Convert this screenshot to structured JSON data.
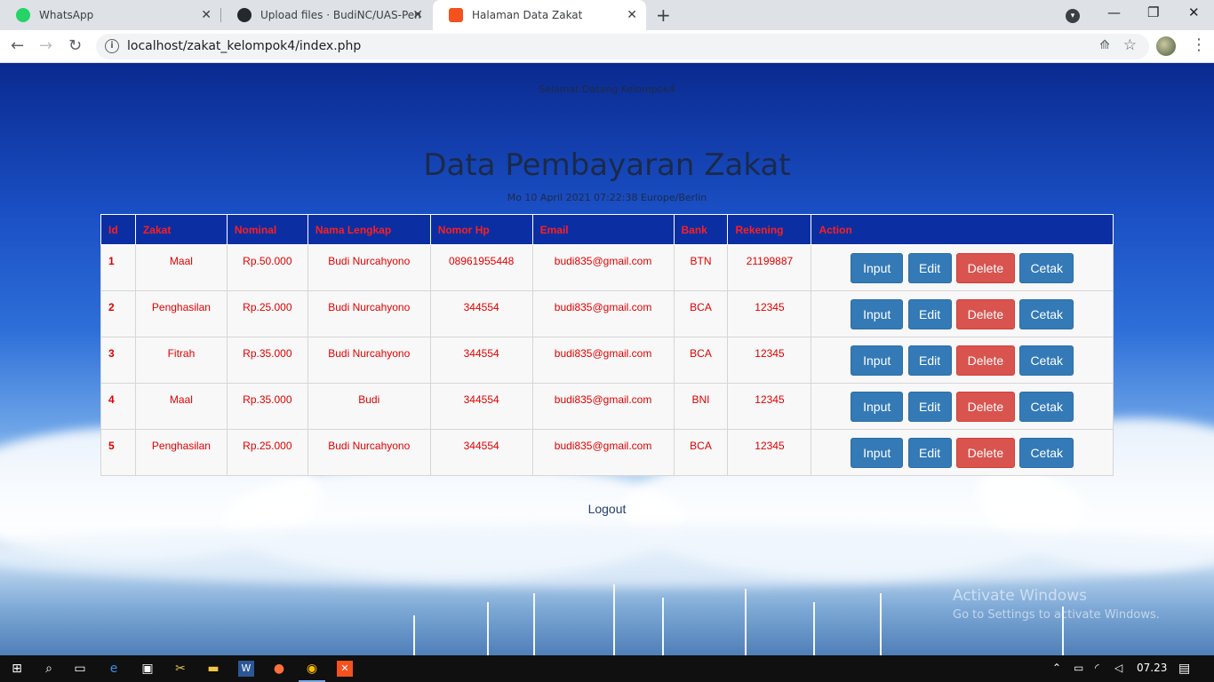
{
  "browser": {
    "tabs": [
      {
        "title": "WhatsApp",
        "active": false,
        "favicon_color": "#25d366"
      },
      {
        "title": "Upload files · BudiNC/UAS-Pemrc",
        "active": false,
        "favicon_color": "#24292e"
      },
      {
        "title": "Halaman Data Zakat",
        "active": true,
        "favicon_color": "#f4511e"
      }
    ],
    "url": "localhost/zakat_kelompok4/index.php"
  },
  "page": {
    "welcome": "Selamat Datang Kelompok4",
    "title": "Data Pembayaran Zakat",
    "date": "Mo 10 April 2021 07:22:38 Europe/Berlin",
    "logout": "Logout",
    "table": {
      "headers": [
        "Id",
        "Zakat",
        "Nominal",
        "Nama Lengkap",
        "Nomor Hp",
        "Email",
        "Bank",
        "Rekening",
        "Action"
      ],
      "rows": [
        {
          "id": "1",
          "zakat": "Maal",
          "nominal": "Rp.50.000",
          "nama": "Budi Nurcahyono",
          "hp": "08961955448",
          "email": "budi835@gmail.com",
          "bank": "BTN",
          "rekening": "21199887"
        },
        {
          "id": "2",
          "zakat": "Penghasilan",
          "nominal": "Rp.25.000",
          "nama": "Budi Nurcahyono",
          "hp": "344554",
          "email": "budi835@gmail.com",
          "bank": "BCA",
          "rekening": "12345"
        },
        {
          "id": "3",
          "zakat": "Fitrah",
          "nominal": "Rp.35.000",
          "nama": "Budi Nurcahyono",
          "hp": "344554",
          "email": "budi835@gmail.com",
          "bank": "BCA",
          "rekening": "12345"
        },
        {
          "id": "4",
          "zakat": "Maal",
          "nominal": "Rp.35.000",
          "nama": "Budi",
          "hp": "344554",
          "email": "budi835@gmail.com",
          "bank": "BNI",
          "rekening": "12345"
        },
        {
          "id": "5",
          "zakat": "Penghasilan",
          "nominal": "Rp.25.000",
          "nama": "Budi Nurcahyono",
          "hp": "344554",
          "email": "budi835@gmail.com",
          "bank": "BCA",
          "rekening": "12345"
        }
      ],
      "actions": {
        "input": "Input",
        "edit": "Edit",
        "delete": "Delete",
        "cetak": "Cetak"
      }
    }
  },
  "watermark": {
    "line1": "Activate Windows",
    "line2": "Go to Settings to activate Windows."
  },
  "taskbar": {
    "clock": "07.23"
  },
  "colors": {
    "header_bg": "#0b2fa3",
    "header_text": "#ff1e1e",
    "cell_text": "#e00000",
    "btn_primary": "#337ab7",
    "btn_danger": "#d9534f"
  }
}
